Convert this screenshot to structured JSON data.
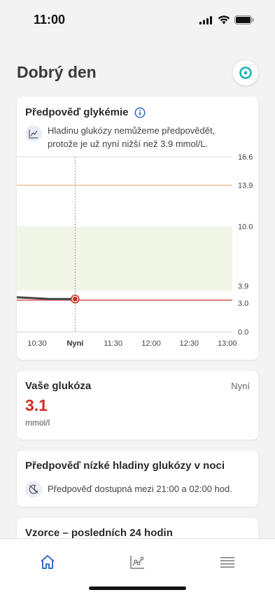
{
  "status": {
    "time": "11:00"
  },
  "greeting": "Dobrý den",
  "forecast": {
    "title": "Předpověď glykémie",
    "message": "Hladinu glukózy nemůžeme předpovědět, protože je už nyní nižší než 3.9 mmol/L."
  },
  "chart_data": {
    "type": "line",
    "ylim": [
      0,
      16.6
    ],
    "y_ticks": [
      "16.6",
      "13.9",
      "10.0",
      "3.9",
      "3.0",
      "0.0"
    ],
    "x_ticks": [
      "10:30",
      "Nyní",
      "11:30",
      "12:00",
      "12:30",
      "13:00"
    ],
    "target_range": [
      3.9,
      10.0
    ],
    "high_threshold": 13.9,
    "low_threshold": 3.0,
    "series": [
      {
        "x": [
          "09:55",
          "10:10",
          "10:25",
          "10:40",
          "10:55",
          "11:00"
        ],
        "values": [
          3.4,
          3.3,
          3.2,
          3.1,
          3.1,
          3.1
        ]
      }
    ],
    "colors": {
      "target": "#f1f6e6",
      "high": "#f5c59a",
      "low": "#e06262",
      "line": "#444444",
      "current": "#d22d24"
    }
  },
  "glucose": {
    "title": "Vaše glukóza",
    "time": "Nyní",
    "value": "3.1",
    "unit": "mmol/l"
  },
  "night": {
    "title": "Předpověď nízké hladiny glukózy v noci",
    "message": "Předpověď dostupná mezi 21:00 a 02:00 hod."
  },
  "patterns": {
    "title": "Vzorce – posledních 24 hodin"
  },
  "nav": {
    "items": [
      "home-icon",
      "chart-icon",
      "menu-icon"
    ],
    "active_color": "#1f5fbf"
  }
}
